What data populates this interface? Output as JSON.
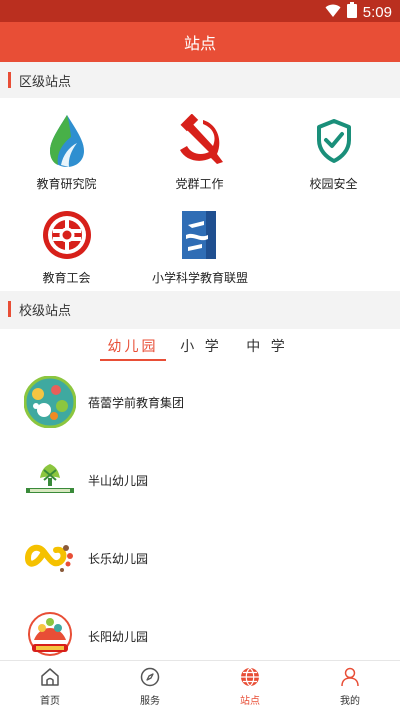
{
  "status_bar": {
    "time": "5:09",
    "icons": [
      "wifi-icon",
      "battery-icon"
    ]
  },
  "header": {
    "title": "站点"
  },
  "district_section": {
    "title": "区级站点",
    "sites": [
      {
        "label": "教育研究院",
        "icon": "education-institute-icon"
      },
      {
        "label": "党群工作",
        "icon": "party-emblem-icon"
      },
      {
        "label": "校园安全",
        "icon": "shield-check-icon"
      },
      {
        "label": "教育工会",
        "icon": "union-emblem-icon"
      },
      {
        "label": "小学科学教育联盟",
        "icon": "science-alliance-icon"
      }
    ]
  },
  "school_section": {
    "title": "校级站点",
    "tabs": [
      {
        "label": "幼儿园",
        "active": true
      },
      {
        "label": "小 学",
        "active": false
      },
      {
        "label": "中 学",
        "active": false
      }
    ],
    "schools": [
      {
        "name": "蓓蕾学前教育集团",
        "logo": "beilei-logo"
      },
      {
        "name": "半山幼儿园",
        "logo": "banshan-logo"
      },
      {
        "name": "长乐幼儿园",
        "logo": "changle-logo"
      },
      {
        "name": "长阳幼儿园",
        "logo": "changyang-logo"
      }
    ]
  },
  "bottom_nav": {
    "items": [
      {
        "label": "首页",
        "icon": "home-icon",
        "active": false
      },
      {
        "label": "服务",
        "icon": "compass-icon",
        "active": false
      },
      {
        "label": "站点",
        "icon": "globe-icon",
        "active": true
      },
      {
        "label": "我的",
        "icon": "user-icon",
        "active": false
      }
    ]
  },
  "colors": {
    "primary": "#e84e36",
    "status_bar": "#ba2f1f",
    "party_red": "#d7201a",
    "safety_teal": "#1a8f7a",
    "alliance_blue": "#2f6db5"
  }
}
